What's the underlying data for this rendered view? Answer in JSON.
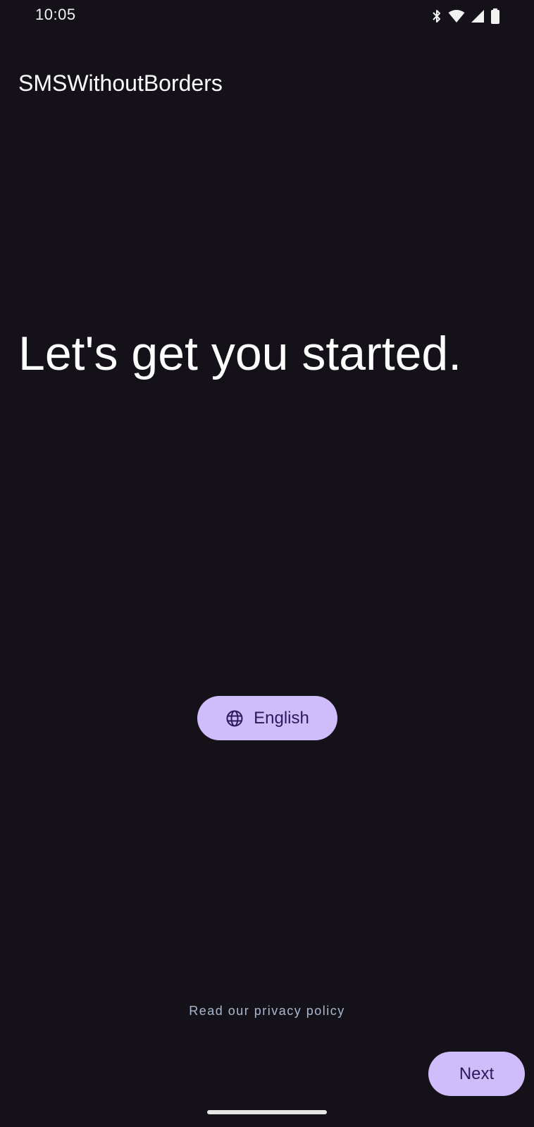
{
  "status_bar": {
    "time": "10:05",
    "icons": [
      "bluetooth-icon",
      "wifi-icon",
      "cellular-signal-icon",
      "battery-icon"
    ]
  },
  "app": {
    "title": "SMSWithoutBorders"
  },
  "onboarding": {
    "headline": "Let's get you started.",
    "language_button": {
      "icon": "globe-icon",
      "label": "English"
    },
    "privacy_link": "Read our privacy policy",
    "next_label": "Next"
  },
  "colors": {
    "background": "#141218",
    "primary_container": "#cfbcfa",
    "on_primary_container": "#2a1a5e",
    "link": "#a9b8cf"
  }
}
